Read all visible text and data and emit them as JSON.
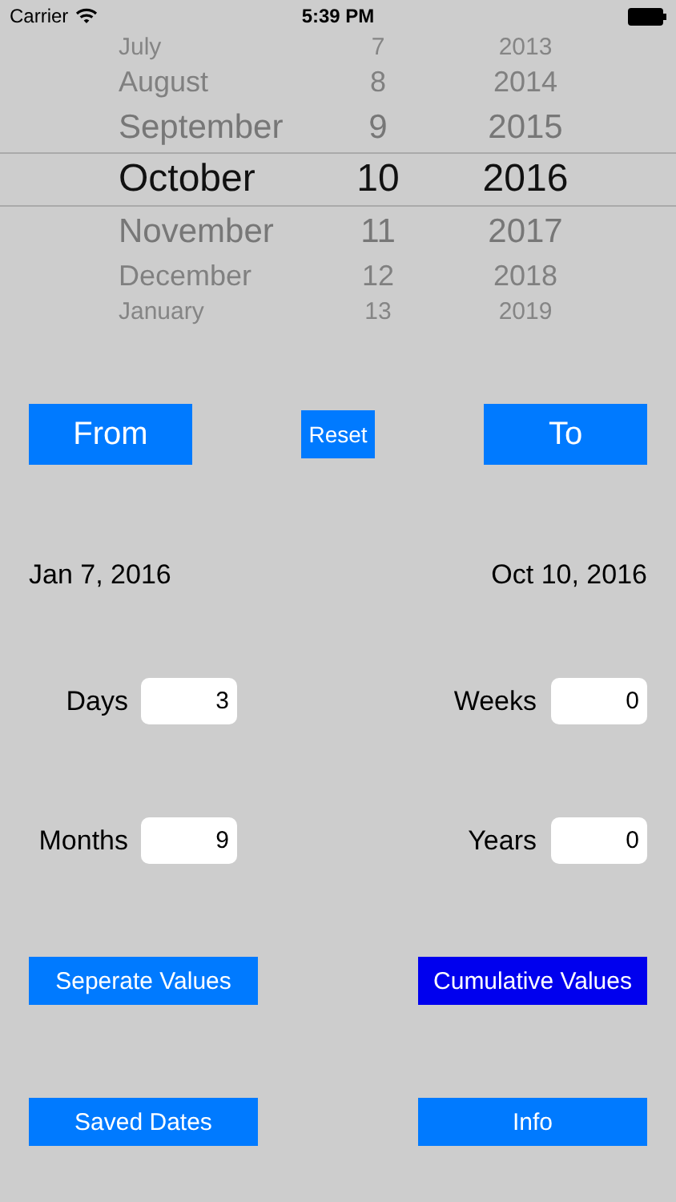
{
  "status_bar": {
    "carrier": "Carrier",
    "time": "5:39 PM"
  },
  "picker": {
    "rows": [
      {
        "month": "July",
        "day": "7",
        "year": "2013",
        "selected": false
      },
      {
        "month": "August",
        "day": "8",
        "year": "2014",
        "selected": false
      },
      {
        "month": "September",
        "day": "9",
        "year": "2015",
        "selected": false
      },
      {
        "month": "October",
        "day": "10",
        "year": "2016",
        "selected": true
      },
      {
        "month": "November",
        "day": "11",
        "year": "2017",
        "selected": false
      },
      {
        "month": "December",
        "day": "12",
        "year": "2018",
        "selected": false
      },
      {
        "month": "January",
        "day": "13",
        "year": "2019",
        "selected": false
      }
    ]
  },
  "range_buttons": [
    "From",
    "Reset",
    "To"
  ],
  "dates": {
    "from": "Jan 7, 2016",
    "to": "Oct 10, 2016"
  },
  "fields": [
    {
      "label": "Days",
      "value": "3"
    },
    {
      "label": "Weeks",
      "value": "0"
    },
    {
      "label": "Months",
      "value": "9"
    },
    {
      "label": "Years",
      "value": "0"
    }
  ],
  "mode_buttons": [
    {
      "label": "Seperate Values",
      "selected": false
    },
    {
      "label": "Cumulative Values",
      "selected": true
    }
  ],
  "bottom_buttons": [
    "Saved Dates",
    "Info"
  ]
}
